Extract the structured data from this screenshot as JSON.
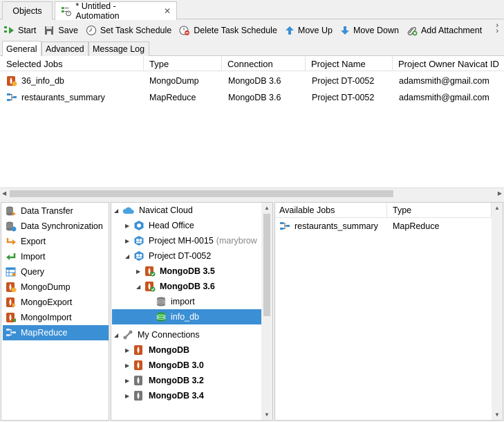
{
  "tabs": [
    {
      "label": "Objects"
    },
    {
      "label": "* Untitled - Automation"
    }
  ],
  "toolbar": {
    "start": "Start",
    "save": "Save",
    "set_schedule": "Set Task Schedule",
    "delete_schedule": "Delete Task Schedule",
    "move_up": "Move Up",
    "move_down": "Move Down",
    "add_attachment": "Add Attachment"
  },
  "subtabs": [
    "General",
    "Advanced",
    "Message Log"
  ],
  "jobs_table": {
    "headers": [
      "Selected Jobs",
      "Type",
      "Connection",
      "Project Name",
      "Project Owner Navicat ID"
    ],
    "rows": [
      [
        "36_info_db",
        "MongoDump",
        "MongoDB 3.6",
        "Project DT-0052",
        "adamsmith@gmail.com"
      ],
      [
        "restaurants_summary",
        "MapReduce",
        "MongoDB 3.6",
        "Project DT-0052",
        "adamsmith@gmail.com"
      ]
    ]
  },
  "job_types": [
    "Data Transfer",
    "Data Synchronization",
    "Export",
    "Import",
    "Query",
    "MongoDump",
    "MongoExport",
    "MongoImport",
    "MapReduce"
  ],
  "tree": {
    "navicat_cloud": "Navicat Cloud",
    "head_office": "Head Office",
    "project_mh": "Project MH-0015",
    "project_mh_owner": "(marybrow",
    "project_dt": "Project DT-0052",
    "mongo35": "MongoDB 3.5",
    "mongo36": "MongoDB 3.6",
    "import_db": "import",
    "info_db": "info_db",
    "my_connections": "My Connections",
    "conn1": "MongoDB",
    "conn2": "MongoDB 3.0",
    "conn3": "MongoDB 3.2",
    "conn4": "MongoDB 3.4"
  },
  "available": {
    "headers": [
      "Available Jobs",
      "Type"
    ],
    "rows": [
      [
        "restaurants_summary",
        "MapReduce"
      ]
    ]
  },
  "colors": {
    "selection": "#3b8fd4",
    "mongo_orange": "#c9541e",
    "mongo_green": "#2e9b3a"
  }
}
